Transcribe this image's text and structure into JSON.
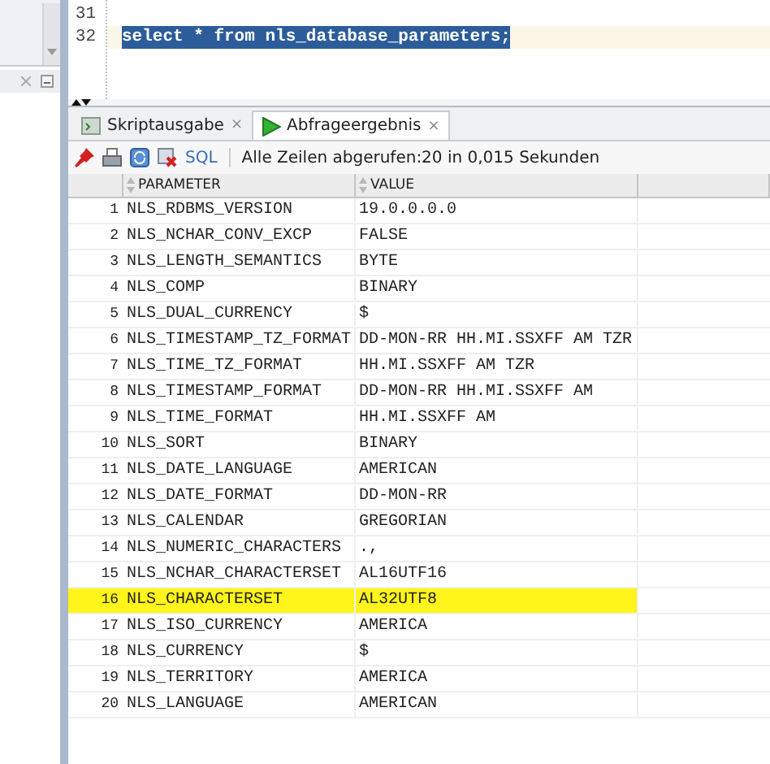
{
  "editor": {
    "lines": [
      {
        "number": "31",
        "selected": false
      },
      {
        "number": "32",
        "code": "select * from nls_database_parameters;",
        "selected": true
      }
    ]
  },
  "tabs": [
    {
      "label": "Skriptausgabe",
      "selected": false,
      "close": "×"
    },
    {
      "label": "Abfrageergebnis",
      "selected": true,
      "close": "×"
    }
  ],
  "toolbar": {
    "sql_label": "SQL",
    "status": "Alle Zeilen abgerufen:20 in 0,015 Sekunden"
  },
  "table": {
    "columns": [
      "PARAMETER",
      "VALUE"
    ],
    "rows": [
      {
        "number": "1",
        "parameter": "NLS_RDBMS_VERSION",
        "value": "19.0.0.0.0",
        "highlighted": false
      },
      {
        "number": "2",
        "parameter": "NLS_NCHAR_CONV_EXCP",
        "value": "FALSE",
        "highlighted": false
      },
      {
        "number": "3",
        "parameter": "NLS_LENGTH_SEMANTICS",
        "value": "BYTE",
        "highlighted": false
      },
      {
        "number": "4",
        "parameter": "NLS_COMP",
        "value": "BINARY",
        "highlighted": false
      },
      {
        "number": "5",
        "parameter": "NLS_DUAL_CURRENCY",
        "value": "$",
        "highlighted": false
      },
      {
        "number": "6",
        "parameter": "NLS_TIMESTAMP_TZ_FORMAT",
        "value": "DD-MON-RR HH.MI.SSXFF AM TZR",
        "highlighted": false
      },
      {
        "number": "7",
        "parameter": "NLS_TIME_TZ_FORMAT",
        "value": "HH.MI.SSXFF AM TZR",
        "highlighted": false
      },
      {
        "number": "8",
        "parameter": "NLS_TIMESTAMP_FORMAT",
        "value": "DD-MON-RR HH.MI.SSXFF AM",
        "highlighted": false
      },
      {
        "number": "9",
        "parameter": "NLS_TIME_FORMAT",
        "value": "HH.MI.SSXFF AM",
        "highlighted": false
      },
      {
        "number": "10",
        "parameter": "NLS_SORT",
        "value": "BINARY",
        "highlighted": false
      },
      {
        "number": "11",
        "parameter": "NLS_DATE_LANGUAGE",
        "value": "AMERICAN",
        "highlighted": false
      },
      {
        "number": "12",
        "parameter": "NLS_DATE_FORMAT",
        "value": "DD-MON-RR",
        "highlighted": false
      },
      {
        "number": "13",
        "parameter": "NLS_CALENDAR",
        "value": "GREGORIAN",
        "highlighted": false
      },
      {
        "number": "14",
        "parameter": "NLS_NUMERIC_CHARACTERS",
        "value": ".,",
        "highlighted": false
      },
      {
        "number": "15",
        "parameter": "NLS_NCHAR_CHARACTERSET",
        "value": "AL16UTF16",
        "highlighted": false
      },
      {
        "number": "16",
        "parameter": "NLS_CHARACTERSET",
        "value": "AL32UTF8",
        "highlighted": true
      },
      {
        "number": "17",
        "parameter": "NLS_ISO_CURRENCY",
        "value": "AMERICA",
        "highlighted": false
      },
      {
        "number": "18",
        "parameter": "NLS_CURRENCY",
        "value": "$",
        "highlighted": false
      },
      {
        "number": "19",
        "parameter": "NLS_TERRITORY",
        "value": "AMERICA",
        "highlighted": false
      },
      {
        "number": "20",
        "parameter": "NLS_LANGUAGE",
        "value": "AMERICAN",
        "highlighted": false
      }
    ]
  }
}
